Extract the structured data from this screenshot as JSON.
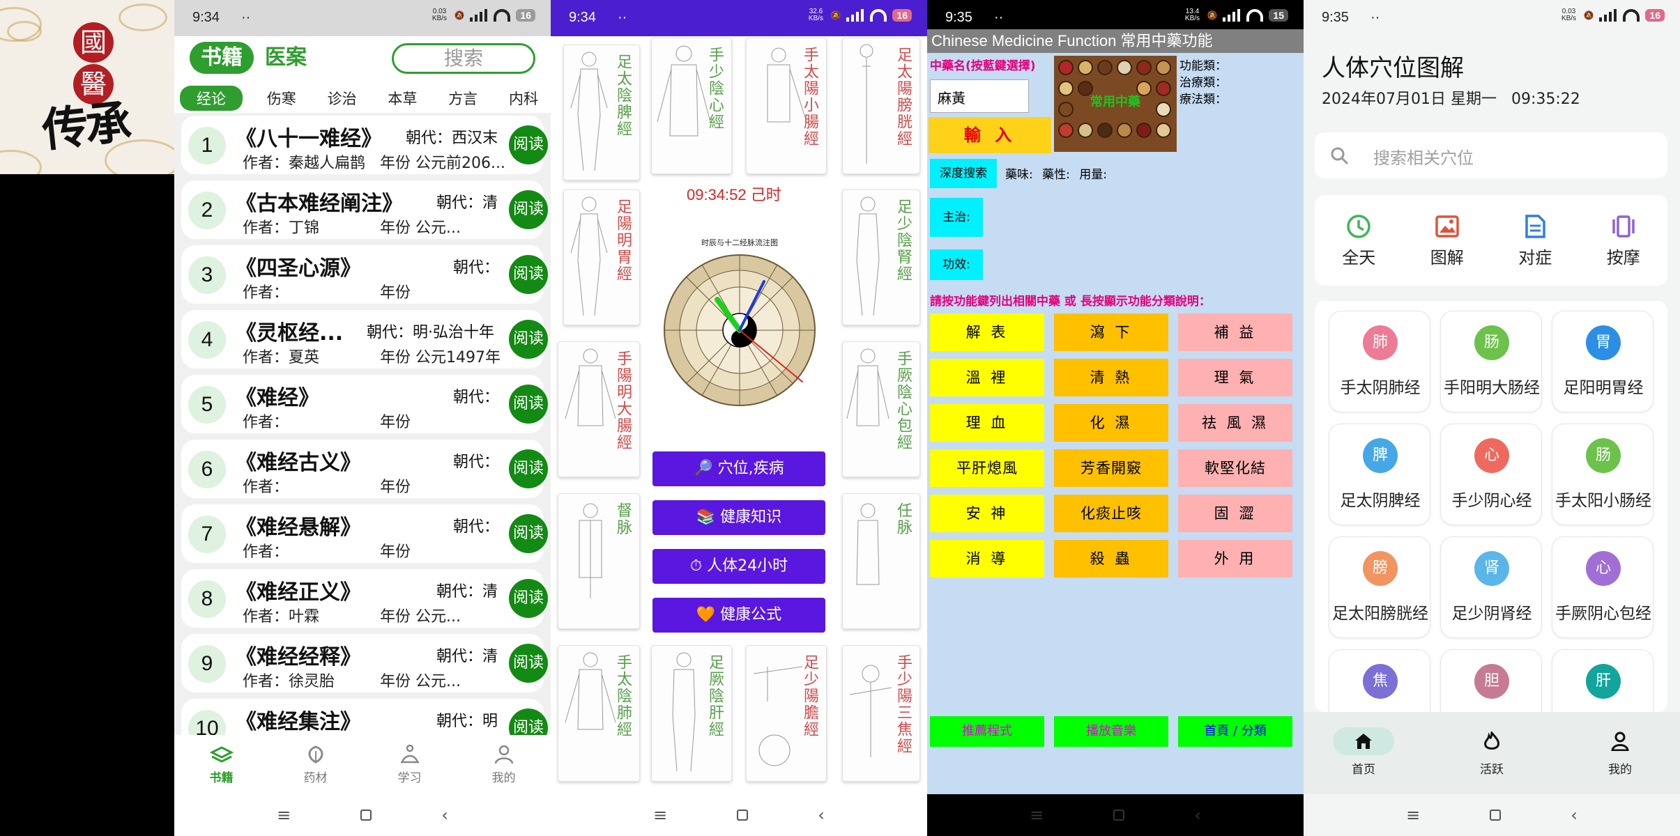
{
  "logo": {
    "chars": [
      "國",
      "醫"
    ],
    "brush": "传承"
  },
  "books_app": {
    "status": {
      "time": "9:34",
      "dots": "··",
      "net_speed": "0.03\nKB/s",
      "battery": "16"
    },
    "tabs": {
      "active": "书籍",
      "other": "医案"
    },
    "search_placeholder": "搜索",
    "categories": [
      "经论",
      "伤寒",
      "诊治",
      "本草",
      "方言",
      "内科"
    ],
    "books": [
      {
        "num": "1",
        "title": "《八十一难经》",
        "dynasty": "朝代：西汉末",
        "author": "作者：秦越人扁鹊",
        "year": "年份 公元前206...",
        "read": "阅读"
      },
      {
        "num": "2",
        "title": "《古本难经阐注》",
        "dynasty": "朝代：清",
        "author": "作者：丁锦",
        "year": "年份 公元...",
        "read": "阅读"
      },
      {
        "num": "3",
        "title": "《四圣心源》",
        "dynasty": "朝代：",
        "author": "作者：",
        "year": "年份",
        "read": "阅读"
      },
      {
        "num": "4",
        "title": "《灵枢经...",
        "dynasty": "朝代：明·弘治十年",
        "author": "作者：夏英",
        "year": "年份 公元1497年",
        "read": "阅读"
      },
      {
        "num": "5",
        "title": "《难经》",
        "dynasty": "朝代：",
        "author": "作者：",
        "year": "年份",
        "read": "阅读"
      },
      {
        "num": "6",
        "title": "《难经古义》",
        "dynasty": "朝代：",
        "author": "作者：",
        "year": "年份",
        "read": "阅读"
      },
      {
        "num": "7",
        "title": "《难经悬解》",
        "dynasty": "朝代：",
        "author": "作者：",
        "year": "年份",
        "read": "阅读"
      },
      {
        "num": "8",
        "title": "《难经正义》",
        "dynasty": "朝代：清",
        "author": "作者：叶霖",
        "year": "年份 公元...",
        "read": "阅读"
      },
      {
        "num": "9",
        "title": "《难经经释》",
        "dynasty": "朝代：清",
        "author": "作者：徐灵胎",
        "year": "年份 公元...",
        "read": "阅读"
      },
      {
        "num": "10",
        "title": "《难经集注》",
        "dynasty": "朝代：明",
        "author": "",
        "year": "",
        "read": "阅读"
      }
    ],
    "bottom_nav": [
      "书籍",
      "药材",
      "学习",
      "我的"
    ],
    "accent": "#2e9e2e"
  },
  "meridian_app": {
    "status": {
      "time": "9:34",
      "dots": "··",
      "net_speed": "32.6\nKB/s",
      "battery": "16"
    },
    "meridians": [
      "足太陰脾經",
      "手少陰心經",
      "手太陽小腸經",
      "足太陽膀胱經",
      "足陽明胃經",
      "足少陰腎經",
      "手陽明大腸經",
      "手厥陰心包經",
      "督脉",
      "任脉",
      "手太陰肺經",
      "足厥陰肝經",
      "足少陽膽經",
      "手少陽三焦經"
    ],
    "clock_text": "09:34:52  己时",
    "clock_title": "时辰与十二经脉流注图",
    "buttons": [
      "🔎 穴位,疾病",
      "📚 健康知识",
      "⏱ 人体24小时",
      "🧡 健康公式"
    ],
    "accent": "#5a17e0"
  },
  "herb_app": {
    "status": {
      "time": "9:35",
      "dots": "··",
      "net_speed": "13.4\nKB/s",
      "battery": "15"
    },
    "title": "Chinese Medicine Function 常用中藥功能",
    "name_label": "中藥名(按藍鍵選擇)",
    "input_value": "麻黃",
    "enter_button": "輸 入",
    "photo_label": "常用中藥",
    "classes": [
      "功能類：",
      "治療類：",
      "療法類："
    ],
    "deep_search": "深度搜索",
    "props": "藥味:  藥性:  用量:",
    "indication": "主治:",
    "effect": "功效:",
    "hint": "請按功能鍵列出相關中藥 或 長按顯示功能分類說明：",
    "function_buttons": [
      [
        "解 表",
        "瀉 下",
        "補 益"
      ],
      [
        "溫 裡",
        "清 熱",
        "理 氣"
      ],
      [
        "理 血",
        "化 濕",
        "祛 風 濕"
      ],
      [
        "平肝熄風",
        "芳香開竅",
        "軟堅化結"
      ],
      [
        "安 神",
        "化痰止咳",
        "固 澀"
      ],
      [
        "消 導",
        "殺 蟲",
        "外 用"
      ]
    ],
    "bottom_buttons": [
      "推薦程式",
      "播放音樂",
      "首頁 / 分類"
    ]
  },
  "acupoint_app": {
    "status": {
      "time": "9:35",
      "dots": "··",
      "net_speed": "0.03\nKB/s",
      "battery": "16"
    },
    "title": "人体穴位图解",
    "date": "2024年07月01日 星期一   09:35:22",
    "search_placeholder": "搜索相关穴位",
    "quick": [
      {
        "label": "全天",
        "icon": "clock-icon",
        "color": "#3fb55a"
      },
      {
        "label": "图解",
        "icon": "image-icon",
        "color": "#e0533b"
      },
      {
        "label": "对症",
        "icon": "document-icon",
        "color": "#2f7fe0"
      },
      {
        "label": "按摩",
        "icon": "massage-icon",
        "color": "#8a64d6"
      }
    ],
    "meridians": [
      {
        "badge": "肺",
        "name": "手太阴肺经",
        "color": "#ee7b95"
      },
      {
        "badge": "肠",
        "name": "手阳明大肠经",
        "color": "#6cc24a"
      },
      {
        "badge": "胃",
        "name": "足阳明胃经",
        "color": "#2d8ee6"
      },
      {
        "badge": "脾",
        "name": "足太阴脾经",
        "color": "#46a7e6"
      },
      {
        "badge": "心",
        "name": "手少阴心经",
        "color": "#ef6a5e"
      },
      {
        "badge": "肠",
        "name": "手太阳小肠经",
        "color": "#6cc24a"
      },
      {
        "badge": "膀",
        "name": "足太阳膀胱经",
        "color": "#f29460"
      },
      {
        "badge": "肾",
        "name": "足少阴肾经",
        "color": "#5ab6e8"
      },
      {
        "badge": "心",
        "name": "手厥阴心包经",
        "color": "#a06fd6"
      },
      {
        "badge": "焦",
        "name": "",
        "color": "#7c6fd6"
      },
      {
        "badge": "胆",
        "name": "",
        "color": "#c77a94"
      },
      {
        "badge": "肝",
        "name": "",
        "color": "#12a59c"
      }
    ],
    "bottom_nav": [
      "首页",
      "活跃",
      "我的"
    ]
  }
}
